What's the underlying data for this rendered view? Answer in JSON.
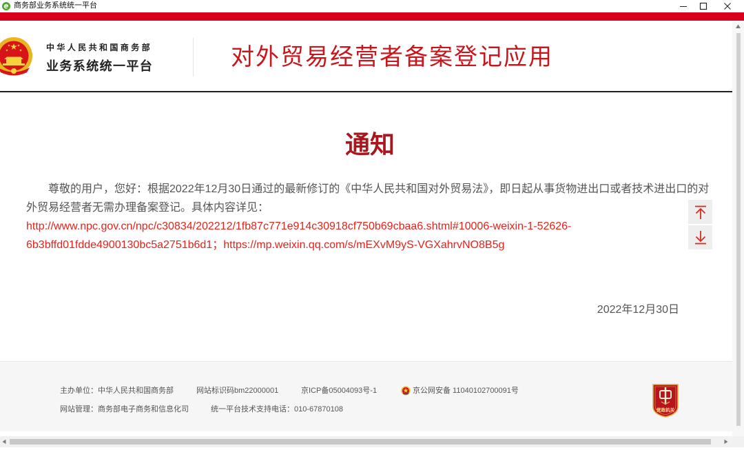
{
  "window": {
    "title": "商务部业务系统统一平台",
    "app_icon": "browser-e-icon",
    "minimize_icon": "minimize-icon",
    "maximize_icon": "maximize-icon",
    "close_icon": "close-icon"
  },
  "header": {
    "emblem_icon": "national-emblem-icon",
    "org_name": "中华人民共和国商务部",
    "platform_name": "业务系统统一平台",
    "app_title": "对外贸易经营者备案登记应用"
  },
  "notice": {
    "title": "通知",
    "body": "尊敬的用户，您好：根据2022年12月30日通过的最新修订的《中华人民共和国对外贸易法》，即日起从事货物进出口或者技术进出口的对外贸易经营者无需办理备案登记。具体内容详见：",
    "links": [
      {
        "text": "http://www.npc.gov.cn/npc/c30834/202212/1fb87c771e914c30918cf750b69cbaa6.shtml#10006-weixin-1-52626-6b3bffd01fdde4900130bc5a2751b6d1"
      },
      {
        "text": "https://mp.weixin.qq.com/s/mEXvM9yS-VGXahrvNO8B5g"
      }
    ],
    "link_separator": "；",
    "date": "2022年12月30日"
  },
  "scroll_buttons": {
    "top_icon": "arrow-to-top-icon",
    "bottom_icon": "arrow-to-bottom-icon"
  },
  "footer": {
    "sponsor": "主办单位：中华人民共和国商务部",
    "site_id": "网站标识码bm22000001",
    "icp": "京ICP备05004093号-1",
    "police_icon": "police-badge-icon",
    "police_record": "京公网安备 11040102700091号",
    "manager": "网站管理：商务部电子商务和信息化司",
    "support_phone": "统一平台技术支持电话：010-67870108",
    "seal_icon": "party-government-seal-icon",
    "seal_text": "党政机关"
  },
  "colors": {
    "top_bar": "#d9001b",
    "app_title": "#c8161d",
    "notice_title": "#a8171d",
    "link": "#e8211a",
    "body_text": "#555555",
    "footer_bg": "#f6f6f6",
    "scroll_button_bg": "#eeeeee",
    "scroll_icon": "#e0271d"
  }
}
